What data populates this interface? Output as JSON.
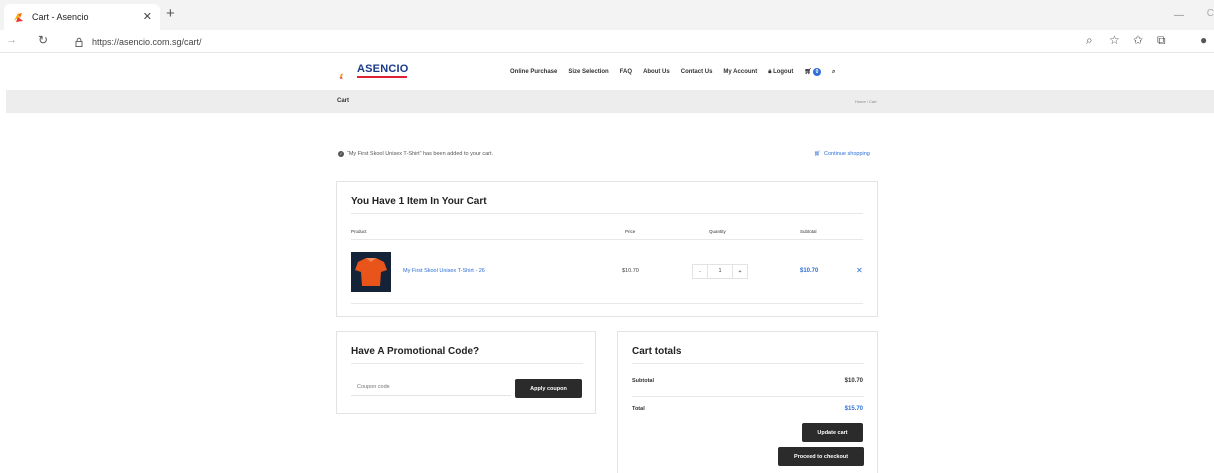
{
  "browser": {
    "tab_title": "Cart - Asencio",
    "url": "https://asencio.com.sg/cart/"
  },
  "site": {
    "logo_text": "ASENCIO",
    "nav": [
      "Online Purchase",
      "Size Selection",
      "FAQ",
      "About Us",
      "Contact Us",
      "My Account",
      "Logout"
    ],
    "cart_count": "0",
    "page_title": "Cart",
    "breadcrumb": "Home / Cart"
  },
  "notice": {
    "message": "“My First Skool Unisex T-Shirt” has been added to your cart.",
    "continue_label": "Continue shopping"
  },
  "cart": {
    "heading": "You Have 1 Item In Your Cart",
    "columns": {
      "product": "Product",
      "price": "Price",
      "quantity": "Quantity",
      "subtotal": "Subtotal"
    },
    "items": [
      {
        "name": "My First Skool Unisex T-Shirt - 26",
        "price": "$10.70",
        "quantity": "1",
        "subtotal": "$10.70"
      }
    ]
  },
  "promo": {
    "heading": "Have A Promotional Code?",
    "placeholder": "Coupon code",
    "button": "Apply coupon"
  },
  "totals": {
    "heading": "Cart totals",
    "subtotal_label": "Subtotal",
    "subtotal_value": "$10.70",
    "total_label": "Total",
    "total_value": "$15.70",
    "update_button": "Update cart",
    "checkout_button": "Proceed to checkout"
  },
  "colors": {
    "accent": "#2d6fd6",
    "dark_button": "#2b2b2b",
    "subheader_bg": "#ededed"
  }
}
